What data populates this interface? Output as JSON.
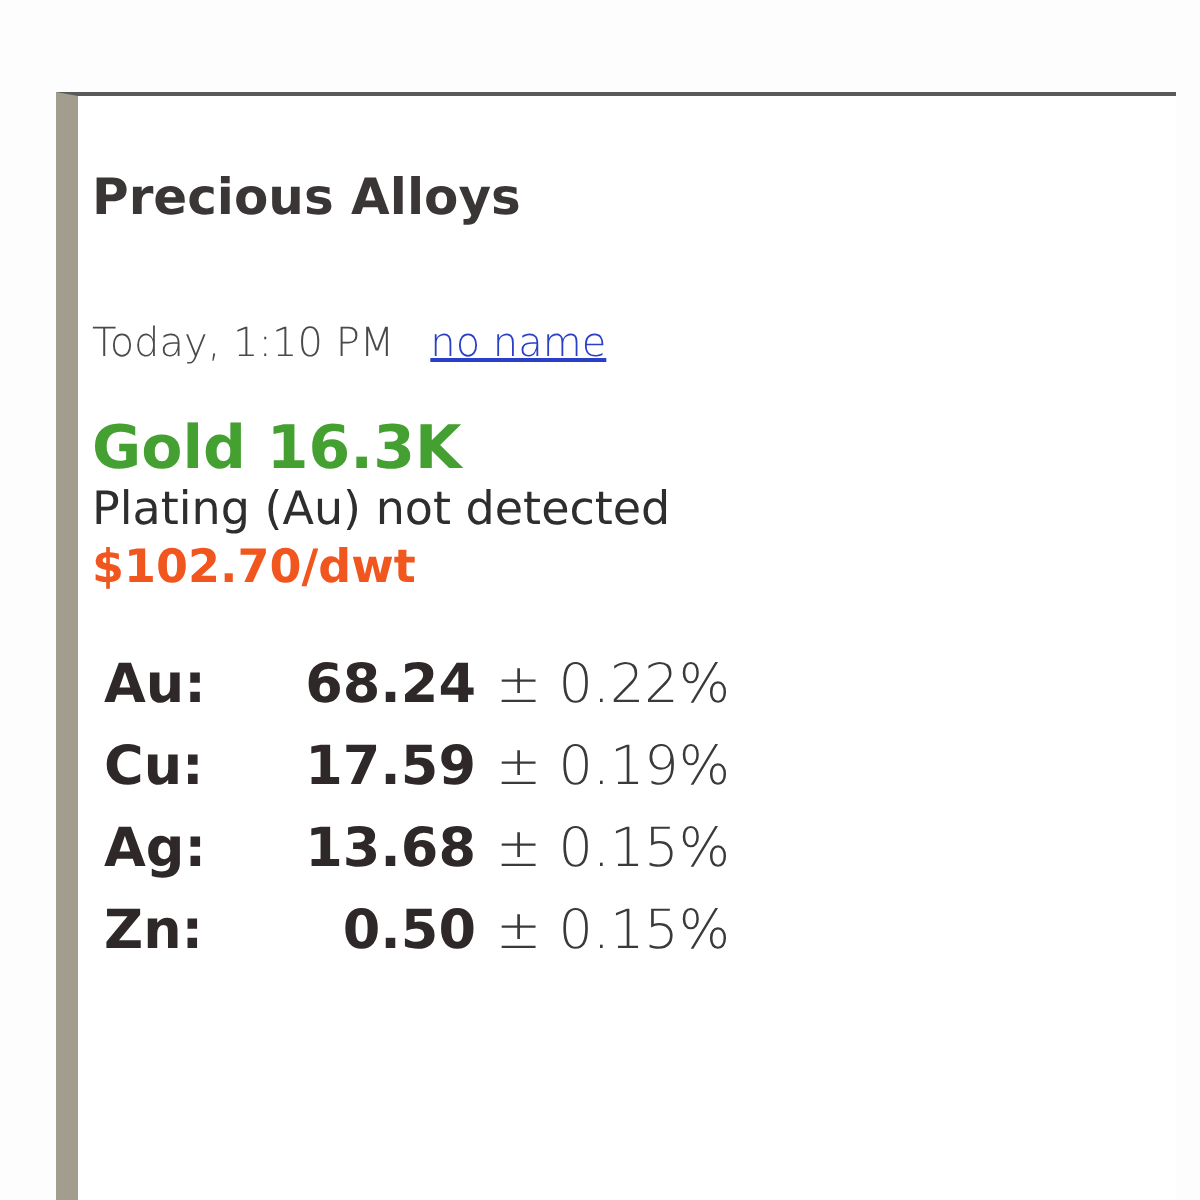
{
  "title": "Precious Alloys",
  "reading": {
    "timestamp": "Today, 1:10 PM",
    "sample_name": "no name"
  },
  "result": {
    "alloy": "Gold 16.3K",
    "plating": "Plating (Au) not detected",
    "price": "$102.70/dwt"
  },
  "elements": [
    {
      "symbol": "Au:",
      "percent": "68.24",
      "uncertainty": "± 0.22%"
    },
    {
      "symbol": "Cu:",
      "percent": "17.59",
      "uncertainty": "± 0.19%"
    },
    {
      "symbol": "Ag:",
      "percent": "13.68",
      "uncertainty": "± 0.15%"
    },
    {
      "symbol": "Zn:",
      "percent": "0.50",
      "uncertainty": "± 0.15%"
    }
  ]
}
